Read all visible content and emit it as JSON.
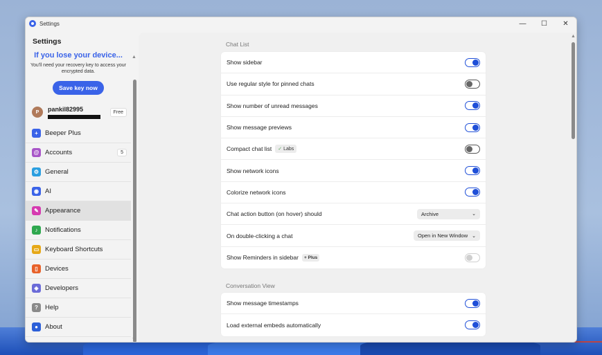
{
  "window": {
    "title": "Settings",
    "controls": {
      "minimize": "—",
      "maximize": "☐",
      "close": "✕"
    }
  },
  "sidebar": {
    "heading": "Settings",
    "recovery": {
      "title": "If you lose your device...",
      "text": "You'll need your recovery key to access your encrypted data.",
      "button": "Save key now"
    },
    "user": {
      "initial": "P",
      "name": "pankil82995",
      "plan": "Free"
    },
    "items": [
      {
        "label": "Beeper Plus",
        "icon": "plus-icon",
        "color": "#3a63e8",
        "glyph": "+"
      },
      {
        "label": "Accounts",
        "icon": "at-icon",
        "color": "#a855c8",
        "glyph": "@",
        "count": "5"
      },
      {
        "label": "General",
        "icon": "gear-icon",
        "color": "#2b9fe0",
        "glyph": "⚙"
      },
      {
        "label": "AI",
        "icon": "robot-icon",
        "color": "#3a63e8",
        "glyph": "◉"
      },
      {
        "label": "Appearance",
        "icon": "brush-icon",
        "color": "#d63ab0",
        "glyph": "✎",
        "active": true
      },
      {
        "label": "Notifications",
        "icon": "bell-icon",
        "color": "#2fa84f",
        "glyph": "♪"
      },
      {
        "label": "Keyboard Shortcuts",
        "icon": "keyboard-icon",
        "color": "#e6a817",
        "glyph": "▭"
      },
      {
        "label": "Devices",
        "icon": "phone-icon",
        "color": "#e8622a",
        "glyph": "▯"
      },
      {
        "label": "Developers",
        "icon": "code-icon",
        "color": "#6b6bd8",
        "glyph": "◈"
      },
      {
        "label": "Help",
        "icon": "help-icon",
        "color": "#8a8a8a",
        "glyph": "?"
      },
      {
        "label": "About",
        "icon": "info-icon",
        "color": "#2b5fd8",
        "glyph": "●"
      }
    ]
  },
  "main": {
    "chat_list": {
      "title": "Chat List",
      "rows": [
        {
          "label": "Show sidebar",
          "control": "toggle",
          "state": "on"
        },
        {
          "label": "Use regular style for pinned chats",
          "control": "toggle",
          "state": "off"
        },
        {
          "label": "Show number of unread messages",
          "control": "toggle",
          "state": "on"
        },
        {
          "label": "Show message previews",
          "control": "toggle",
          "state": "on"
        },
        {
          "label": "Compact chat list",
          "pill": "Labs",
          "control": "toggle",
          "state": "off"
        },
        {
          "label": "Show network icons",
          "control": "toggle",
          "state": "on"
        },
        {
          "label": "Colorize network icons",
          "control": "toggle",
          "state": "on"
        },
        {
          "label": "Chat action button (on hover) should",
          "control": "select",
          "value": "Archive"
        },
        {
          "label": "On double-clicking a chat",
          "control": "select",
          "value": "Open in New Window"
        },
        {
          "label": "Show Reminders in sidebar",
          "plus_pill": "+ Plus",
          "control": "toggle",
          "state": "disabled"
        }
      ]
    },
    "conversation_view": {
      "title": "Conversation View",
      "rows": [
        {
          "label": "Show message timestamps",
          "control": "toggle",
          "state": "on"
        },
        {
          "label": "Load external embeds automatically",
          "control": "toggle",
          "state": "on"
        }
      ]
    }
  }
}
